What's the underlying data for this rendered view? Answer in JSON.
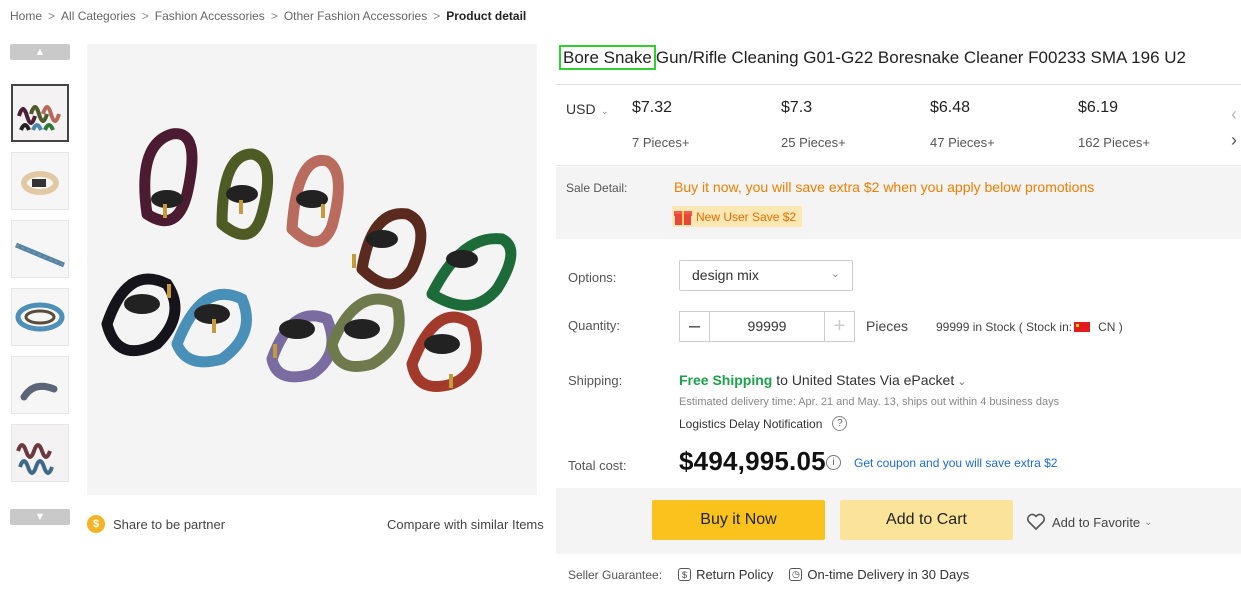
{
  "breadcrumb": {
    "items": [
      "Home",
      "All Categories",
      "Fashion Accessories",
      "Other Fashion Accessories"
    ],
    "current": "Product detail",
    "separator": ">"
  },
  "gallery": {
    "thumb_count": 6,
    "active_thumb": 0
  },
  "share_label": "Share to be partner",
  "compare_label": "Compare with similar Items",
  "product": {
    "title_highlight": "Bore Snake",
    "title_rest": "Gun/Rifle Cleaning G01-G22 Boresnake Cleaner F00233 SMA 196 U2"
  },
  "pricing": {
    "currency": "USD",
    "tiers": [
      {
        "price": "$7.32",
        "qty": "7 Pieces+"
      },
      {
        "price": "$7.3",
        "qty": "25 Pieces+"
      },
      {
        "price": "$6.48",
        "qty": "47 Pieces+"
      },
      {
        "price": "$6.19",
        "qty": "162 Pieces+"
      }
    ]
  },
  "sale": {
    "label": "Sale Detail:",
    "message": "Buy it now, you will save extra $2 when you apply below promotions",
    "badge": "New User Save $2"
  },
  "options": {
    "label": "Options:",
    "selected": "design mix"
  },
  "quantity": {
    "label": "Quantity:",
    "value": "99999",
    "unit": "Pieces",
    "stock_text": "99999 in Stock ( Stock in:",
    "stock_country": "CN )"
  },
  "shipping": {
    "label": "Shipping:",
    "free": "Free Shipping",
    "to": "to",
    "destination": "United States Via ePacket",
    "estimate": "Estimated delivery time: Apr. 21 and May. 13, ships out within 4 business days",
    "delay": "Logistics Delay Notification"
  },
  "total": {
    "label": "Total cost:",
    "value": "$494,995.05",
    "coupon": "Get coupon and you will save extra $2"
  },
  "actions": {
    "buy": "Buy it Now",
    "cart": "Add to Cart",
    "favorite": "Add to Favorite"
  },
  "guarantee": {
    "label": "Seller Guarantee:",
    "return": "Return Policy",
    "delivery": "On-time Delivery in 30 Days"
  },
  "colors": {
    "accent_orange": "#f07d00",
    "buy_button": "#fac21d",
    "cart_button": "#fbe39a",
    "free_shipping": "#1aa34a",
    "link_blue": "#1c6bd6",
    "highlight_box": "#2ed12e"
  }
}
